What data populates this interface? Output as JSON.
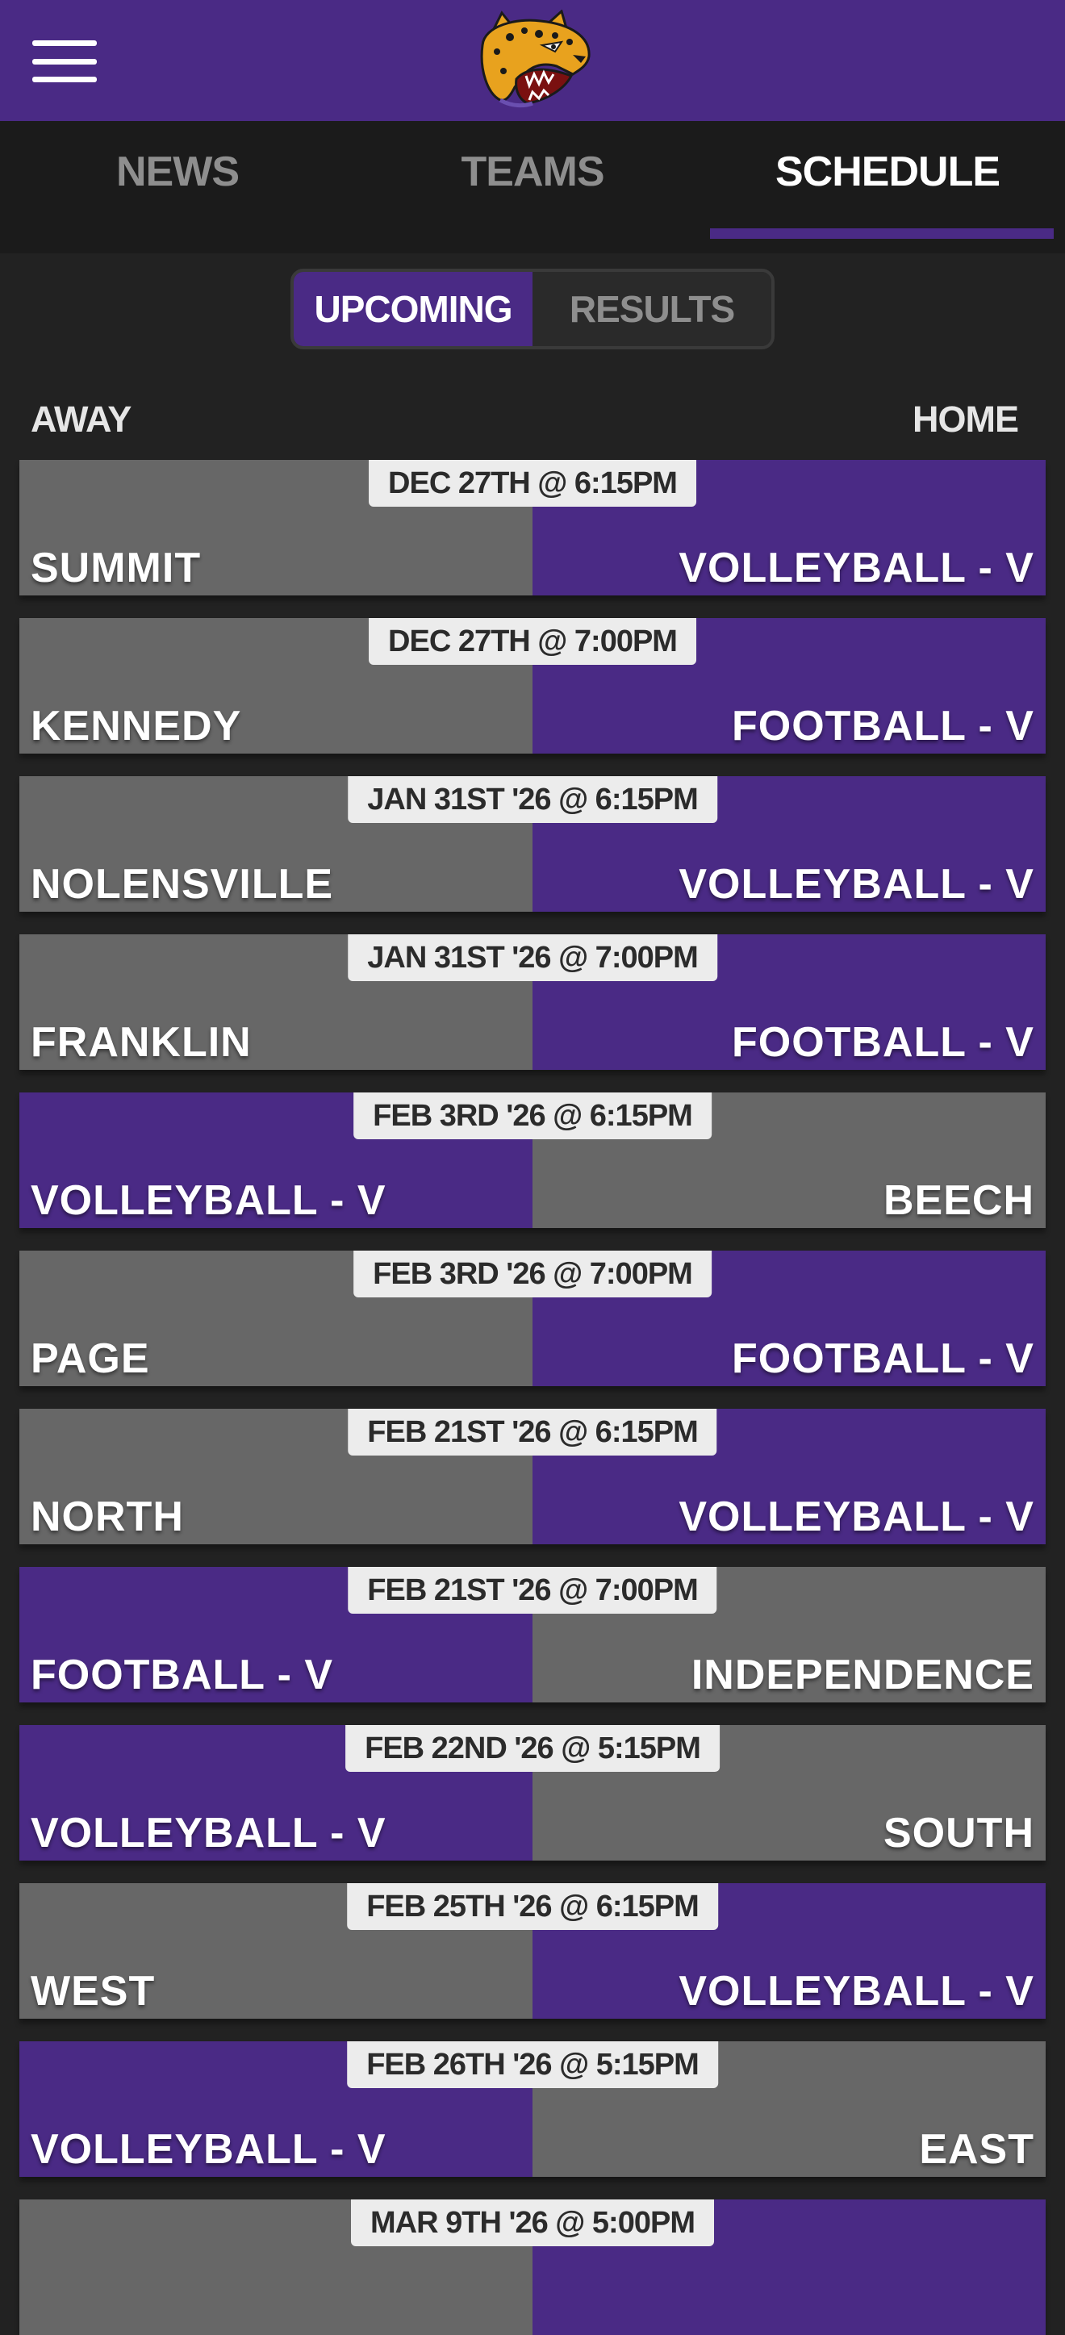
{
  "header": {
    "logo_name": "jaguar-logo"
  },
  "tabs": [
    {
      "label": "NEWS",
      "active": false
    },
    {
      "label": "TEAMS",
      "active": false
    },
    {
      "label": "SCHEDULE",
      "active": true
    }
  ],
  "toggle": {
    "upcoming": "UPCOMING",
    "results": "RESULTS",
    "selected": "UPCOMING"
  },
  "columns": {
    "away": "AWAY",
    "home": "HOME"
  },
  "colors": {
    "purple": "#4a2a85",
    "gray": "#676767",
    "background": "#222222",
    "tabbar": "#1b1b1b"
  },
  "games": [
    {
      "date": "DEC 27TH @ 6:15PM",
      "away": "SUMMIT",
      "home": "VOLLEYBALL - V",
      "highlight": "home"
    },
    {
      "date": "DEC 27TH @ 7:00PM",
      "away": "KENNEDY",
      "home": "FOOTBALL - V",
      "highlight": "home"
    },
    {
      "date": "JAN 31ST '26 @ 6:15PM",
      "away": "NOLENSVILLE",
      "home": "VOLLEYBALL - V",
      "highlight": "home"
    },
    {
      "date": "JAN 31ST '26 @ 7:00PM",
      "away": "FRANKLIN",
      "home": "FOOTBALL - V",
      "highlight": "home"
    },
    {
      "date": "FEB 3RD '26 @ 6:15PM",
      "away": "VOLLEYBALL - V",
      "home": "BEECH",
      "highlight": "away"
    },
    {
      "date": "FEB 3RD '26 @ 7:00PM",
      "away": "PAGE",
      "home": "FOOTBALL - V",
      "highlight": "home"
    },
    {
      "date": "FEB 21ST '26 @ 6:15PM",
      "away": "NORTH",
      "home": "VOLLEYBALL - V",
      "highlight": "home"
    },
    {
      "date": "FEB 21ST '26 @ 7:00PM",
      "away": "FOOTBALL - V",
      "home": "INDEPENDENCE",
      "highlight": "away"
    },
    {
      "date": "FEB 22ND '26 @ 5:15PM",
      "away": "VOLLEYBALL - V",
      "home": "SOUTH",
      "highlight": "away"
    },
    {
      "date": "FEB 25TH '26 @ 6:15PM",
      "away": "WEST",
      "home": "VOLLEYBALL - V",
      "highlight": "home"
    },
    {
      "date": "FEB 26TH '26 @ 5:15PM",
      "away": "VOLLEYBALL - V",
      "home": "EAST",
      "highlight": "away"
    },
    {
      "date": "MAR 9TH '26 @ 5:00PM",
      "away": "",
      "home": "",
      "highlight": "home"
    }
  ]
}
